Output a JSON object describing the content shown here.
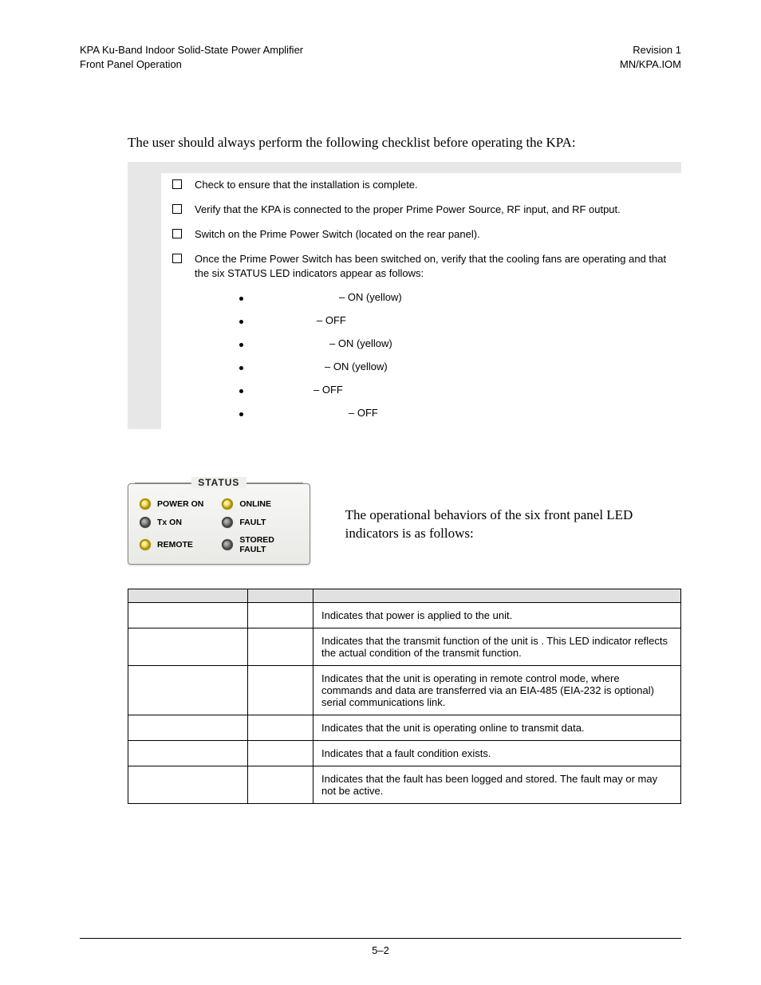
{
  "header": {
    "left_line1": "KPA Ku-Band Indoor Solid-State Power Amplifier",
    "left_line2": "Front Panel Operation",
    "right_line1": "Revision 1",
    "right_line2": "MN/KPA.IOM"
  },
  "intro": "The user should always perform the following checklist before operating the KPA:",
  "step_heading": "",
  "checklist": [
    {
      "text": "Check to ensure that the installation is complete."
    },
    {
      "text": "Verify that the KPA is connected to the proper Prime Power Source, RF input, and RF output."
    },
    {
      "text": "Switch on the Prime Power Switch (located on the rear panel)."
    },
    {
      "text": "Once the Prime Power Switch has been switched on, verify that the cooling fans are operating and that the six STATUS LED indicators appear as follows:"
    }
  ],
  "sub_items": [
    {
      "label": "",
      "state": "– ON (yellow)"
    },
    {
      "label": "",
      "state": "– OFF"
    },
    {
      "label": "",
      "state": "– ON (yellow)"
    },
    {
      "label": "",
      "state": "– ON (yellow)"
    },
    {
      "label": "",
      "state": "– OFF"
    },
    {
      "label": "",
      "state": "– OFF"
    }
  ],
  "status_panel": {
    "title": "STATUS",
    "leds": [
      {
        "label": "POWER ON",
        "color": "yellow"
      },
      {
        "label": "ONLINE",
        "color": "yellow"
      },
      {
        "label": "Tx ON",
        "color": "off"
      },
      {
        "label": "FAULT",
        "color": "off"
      },
      {
        "label": "REMOTE",
        "color": "yellow"
      },
      {
        "label": "STORED FAULT",
        "color": "off"
      }
    ]
  },
  "figure_caption": "The operational behaviors of the six front panel LED indicators is as follows:",
  "table": {
    "headers": [
      "",
      "",
      ""
    ],
    "rows": [
      {
        "led": "",
        "color": "",
        "desc": "Indicates that power is applied to the unit."
      },
      {
        "led": "",
        "color": "",
        "desc": "Indicates that the transmit function of the unit is      . This LED indicator reflects the actual condition of the transmit function."
      },
      {
        "led": "",
        "color": "",
        "desc": "Indicates that the unit is operating in remote control mode, where commands and data are transferred via an EIA-485 (EIA-232 is optional) serial communications link."
      },
      {
        "led": "",
        "color": "",
        "desc": "Indicates that the unit is operating online to transmit data."
      },
      {
        "led": "",
        "color": "",
        "desc": "Indicates that a fault condition exists."
      },
      {
        "led": "",
        "color": "",
        "desc": "Indicates that the fault has been logged and stored. The fault may or may not be active."
      }
    ]
  },
  "footer": {
    "page": "5–2"
  }
}
